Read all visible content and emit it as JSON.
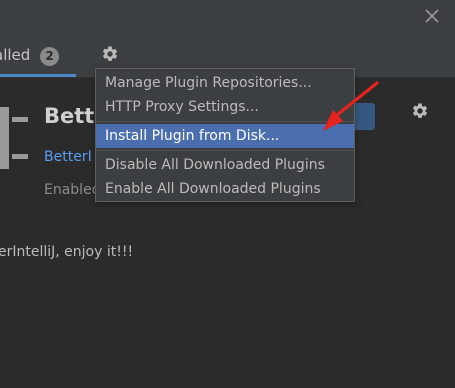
{
  "header": {
    "tab_installed_label": "alled",
    "tab_installed_count": "2",
    "close_icon": "close-icon",
    "settings_icon": "gear-icon"
  },
  "plugin": {
    "title": "Bette",
    "vendor_link": "BetterI",
    "status": "Enabled",
    "description": "erIntelliJ, enjoy it!!!",
    "settings_icon": "gear-icon"
  },
  "menu": {
    "items": [
      {
        "label": "Manage Plugin Repositories..."
      },
      {
        "label": "HTTP Proxy Settings..."
      },
      {
        "label": "Install Plugin from Disk...",
        "selected": true
      },
      {
        "label": "Disable All Downloaded Plugins"
      },
      {
        "label": "Enable All Downloaded Plugins"
      }
    ]
  },
  "colors": {
    "background": "#2b2b2b",
    "header_background": "#3c3f41",
    "selection": "#4b6eaf",
    "link": "#589df6",
    "tab_underline": "#4a88c7",
    "arrow": "#e8231f"
  }
}
